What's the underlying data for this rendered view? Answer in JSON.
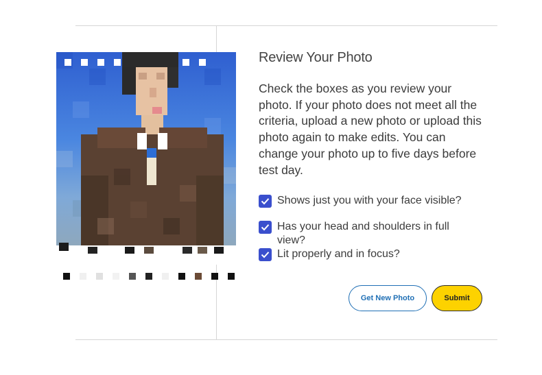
{
  "title": "Review Your Photo",
  "instructions": "Check the boxes as you review your photo. If your photo does not meet all the criteria, upload a new photo or upload this photo again to make edits. You can change your photo up to five days before test day.",
  "checklist": [
    {
      "label": "Shows just you with your face visible?",
      "checked": true
    },
    {
      "label": "Has your head and shoulders in full view?",
      "checked": true
    },
    {
      "label": "Lit properly and in focus?",
      "checked": true
    }
  ],
  "buttons": {
    "get_new_photo": "Get New Photo",
    "submit": "Submit"
  },
  "colors": {
    "checkbox": "#3a4fcd",
    "primary_button": "#fdd200",
    "secondary_button_text": "#1f6fb5",
    "photo_background": "#3a6fd8"
  }
}
